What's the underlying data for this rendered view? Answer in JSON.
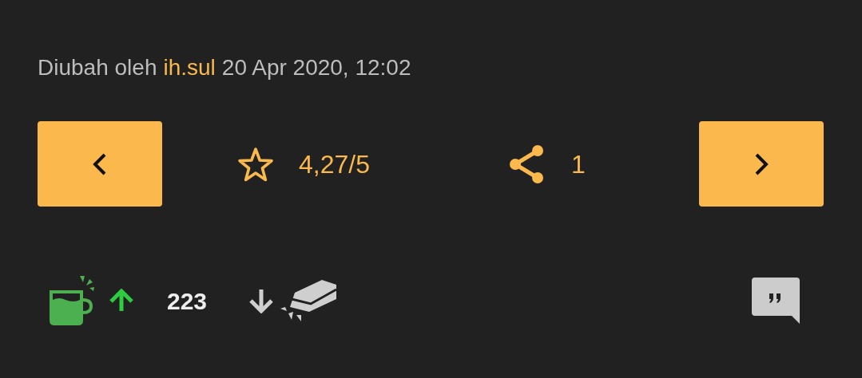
{
  "edited": {
    "prefix": "Diubah oleh",
    "user": "ih.sul",
    "date": "20 Apr 2020, 12:02"
  },
  "rating": "4,27/5",
  "shares": "1",
  "votes": "223"
}
